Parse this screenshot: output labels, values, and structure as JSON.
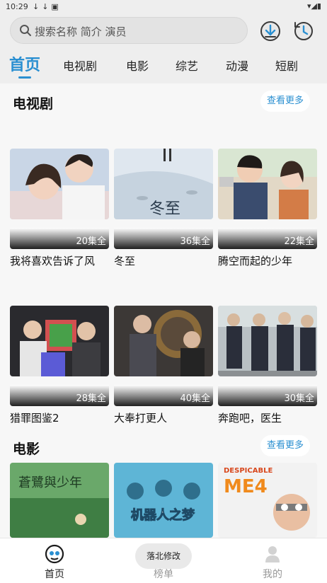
{
  "status": {
    "time": "10:29"
  },
  "search": {
    "placeholder": "搜索名称 简介 演员"
  },
  "header_icons": [
    "download-icon",
    "history-icon"
  ],
  "tabs": [
    {
      "label": "首页",
      "active": true
    },
    {
      "label": "电视剧"
    },
    {
      "label": "电影"
    },
    {
      "label": "综艺"
    },
    {
      "label": "动漫"
    },
    {
      "label": "短剧"
    }
  ],
  "sections": [
    {
      "title": "电视剧",
      "more": "查看更多",
      "items": [
        {
          "name": "我将喜欢告诉了风",
          "episodes": "20集全"
        },
        {
          "name": "冬至",
          "episodes": "36集全"
        },
        {
          "name": "腾空而起的少年",
          "episodes": "22集全"
        },
        {
          "name": "猎罪图鉴2",
          "episodes": "28集全"
        },
        {
          "name": "大奉打更人",
          "episodes": "40集全"
        },
        {
          "name": "奔跑吧，医生",
          "episodes": "30集全"
        }
      ]
    },
    {
      "title": "电影",
      "more": "查看更多",
      "items": [
        {
          "poster_text": [
            "蒼鷺與少年"
          ]
        },
        {
          "poster_text": [
            "机器人之梦"
          ]
        },
        {
          "poster_text": [
            "DESPICABLE",
            "ME4"
          ]
        }
      ]
    }
  ],
  "bottom_nav": [
    {
      "label": "首页",
      "icon": "home-icon",
      "active": true
    },
    {
      "label": "榜单",
      "icon": "ranking-icon"
    },
    {
      "label": "我的",
      "icon": "profile-icon"
    }
  ],
  "toast": "落北修改"
}
